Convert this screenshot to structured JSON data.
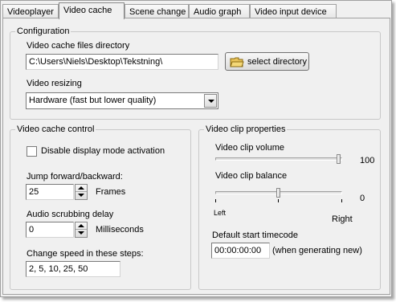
{
  "tabs": [
    {
      "label": "Videoplayer"
    },
    {
      "label": "Video cache"
    },
    {
      "label": "Scene change"
    },
    {
      "label": "Audio graph"
    },
    {
      "label": "Video input device"
    }
  ],
  "configuration": {
    "legend": "Configuration",
    "dir_label": "Video cache files directory",
    "dir_value": "C:\\Users\\Niels\\Desktop\\Tekstning\\",
    "select_dir_label": "select directory",
    "resize_label": "Video resizing",
    "resize_value": "Hardware (fast but lower quality)"
  },
  "cache_control": {
    "legend": "Video cache control",
    "disable_label": "Disable display mode activation",
    "disable_checked": false,
    "jump_label": "Jump forward/backward:",
    "jump_value": "25",
    "jump_unit": "Frames",
    "scrub_label": "Audio scrubbing delay",
    "scrub_value": "0",
    "scrub_unit": "Milliseconds",
    "steps_label": "Change speed in these steps:",
    "steps_value": "2, 5, 10, 25, 50"
  },
  "clip_properties": {
    "legend": "Video clip properties",
    "volume_label": "Video clip volume",
    "volume_value": "100",
    "volume_fraction": 1.0,
    "balance_label": "Video clip balance",
    "balance_value": "0",
    "balance_fraction": 0.5,
    "left_label": "Left",
    "right_label": "Right",
    "timecode_label": "Default start timecode",
    "timecode_value": "00:00:00:00",
    "timecode_note": "(when generating new)"
  }
}
